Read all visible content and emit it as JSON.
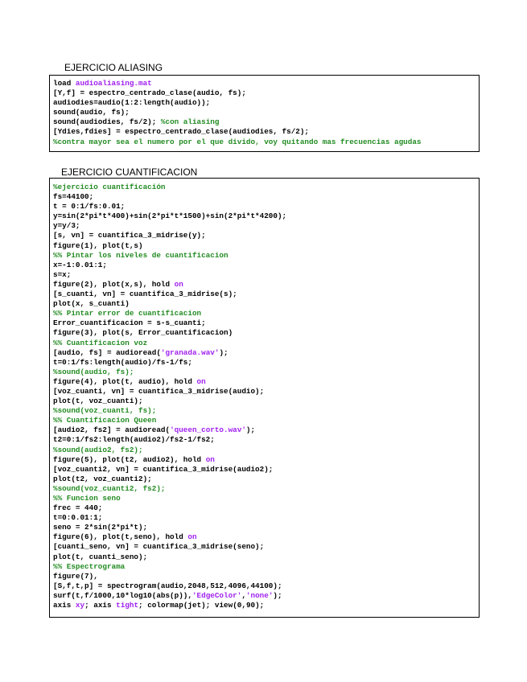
{
  "sections": [
    {
      "title": "EJERCICIO ALIASING",
      "lines": [
        [
          [
            "pl",
            "load "
          ],
          [
            "st",
            "audioaliasing.mat"
          ]
        ],
        [
          [
            "pl",
            "[Y,f] = espectro_centrado_clase(audio, fs);"
          ]
        ],
        [
          [
            "pl",
            "audiodies=audio(1:2:length(audio));"
          ]
        ],
        [
          [
            "pl",
            "sound(audio, fs);"
          ]
        ],
        [
          [
            "pl",
            "sound(audiodies, fs/2); "
          ],
          [
            "cm",
            "%con aliasing"
          ]
        ],
        [
          [
            "pl",
            "[Ydies,fdies] = espectro_centrado_clase(audiodies, fs/2);"
          ]
        ],
        [
          [
            "cm",
            "%contra mayor sea el numero por el que divido, voy quitando mas frecuencias agudas"
          ]
        ]
      ]
    },
    {
      "title": "EJERCICIO CUANTIFICACION",
      "lines": [
        [
          [
            "cm",
            "%ejercicio cuantificación"
          ]
        ],
        [
          [
            "pl",
            "fs=44100;"
          ]
        ],
        [
          [
            "pl",
            "t = 0:1/fs:0.01;"
          ]
        ],
        [
          [
            "pl",
            "y=sin(2*pi*t*400)+sin(2*pi*t*1500)+sin(2*pi*t*4200);"
          ]
        ],
        [
          [
            "pl",
            "y=y/3;"
          ]
        ],
        [
          [
            "pl",
            "[s, vn] = cuantifica_3_midrise(y);"
          ]
        ],
        [
          [
            "pl",
            "figure(1), plot(t,s)"
          ]
        ],
        [
          [
            "cm",
            "%% Pintar los niveles de cuantificacion"
          ]
        ],
        [
          [
            "pl",
            "x=-1:0.01:1;"
          ]
        ],
        [
          [
            "pl",
            "s=x;"
          ]
        ],
        [
          [
            "pl",
            "figure(2), plot(x,s), hold "
          ],
          [
            "kw",
            "on"
          ]
        ],
        [
          [
            "pl",
            "[s_cuanti, vn] = cuantifica_3_midrise(s);"
          ]
        ],
        [
          [
            "pl",
            "plot(x, s_cuanti)"
          ]
        ],
        [
          [
            "cm",
            "%% Pintar error de cuantificacion"
          ]
        ],
        [
          [
            "pl",
            "Error_cuantificacion = s-s_cuanti;"
          ]
        ],
        [
          [
            "pl",
            "figure(3), plot(s, Error_cuantificacion)"
          ]
        ],
        [
          [
            "cm",
            "%% Cuantificacion voz"
          ]
        ],
        [
          [
            "pl",
            "[audio, fs] = audioread("
          ],
          [
            "st",
            "'granada.wav'"
          ],
          [
            "pl",
            ");"
          ]
        ],
        [
          [
            "pl",
            "t=0:1/fs:length(audio)/fs-1/fs;"
          ]
        ],
        [
          [
            "cm",
            "%sound(audio, fs);"
          ]
        ],
        [
          [
            "pl",
            "figure(4), plot(t, audio), hold "
          ],
          [
            "kw",
            "on"
          ]
        ],
        [
          [
            "pl",
            "[voz_cuanti, vn] = cuantifica_3_midrise(audio);"
          ]
        ],
        [
          [
            "pl",
            "plot(t, voz_cuanti);"
          ]
        ],
        [
          [
            "cm",
            "%sound(voz_cuanti, fs);"
          ]
        ],
        [
          [
            "cm",
            "%% Cuantificacion Queen"
          ]
        ],
        [
          [
            "pl",
            "[audio2, fs2] = audioread("
          ],
          [
            "st",
            "'queen_corto.wav'"
          ],
          [
            "pl",
            ");"
          ]
        ],
        [
          [
            "pl",
            "t2=0:1/fs2:length(audio2)/fs2-1/fs2;"
          ]
        ],
        [
          [
            "cm",
            "%sound(audio2, fs2);"
          ]
        ],
        [
          [
            "pl",
            "figure(5), plot(t2, audio2), hold "
          ],
          [
            "kw",
            "on"
          ]
        ],
        [
          [
            "pl",
            "[voz_cuanti2, vn] = cuantifica_3_midrise(audio2);"
          ]
        ],
        [
          [
            "pl",
            "plot(t2, voz_cuanti2);"
          ]
        ],
        [
          [
            "cm",
            "%sound(voz_cuanti2, fs2);"
          ]
        ],
        [
          [
            "cm",
            "%% Funcion seno"
          ]
        ],
        [
          [
            "pl",
            "frec = 440;"
          ]
        ],
        [
          [
            "pl",
            "t=0:0.01:1;"
          ]
        ],
        [
          [
            "pl",
            "seno = 2*sin(2*pi*t);"
          ]
        ],
        [
          [
            "pl",
            "figure(6), plot(t,seno), hold "
          ],
          [
            "kw",
            "on"
          ]
        ],
        [
          [
            "pl",
            "[cuanti_seno, vn] = cuantifica_3_midrise(seno);"
          ]
        ],
        [
          [
            "pl",
            "plot(t, cuanti_seno);"
          ]
        ],
        [
          [
            "cm",
            "%% Espectrograma"
          ]
        ],
        [
          [
            "pl",
            "figure(7),"
          ]
        ],
        [
          [
            "pl",
            "[S,f,t,p] = spectrogram(audio,2048,512,4096,44100);"
          ]
        ],
        [
          [
            "pl",
            "surf(t,f/1000,10*log10(abs(p)),"
          ],
          [
            "st",
            "'EdgeColor'"
          ],
          [
            "pl",
            ","
          ],
          [
            "st",
            "'none'"
          ],
          [
            "pl",
            ");"
          ]
        ],
        [
          [
            "pl",
            "axis "
          ],
          [
            "kw",
            "xy"
          ],
          [
            "pl",
            "; axis "
          ],
          [
            "kw",
            "tight"
          ],
          [
            "pl",
            "; colormap(jet); view(0,90);"
          ]
        ]
      ]
    }
  ]
}
